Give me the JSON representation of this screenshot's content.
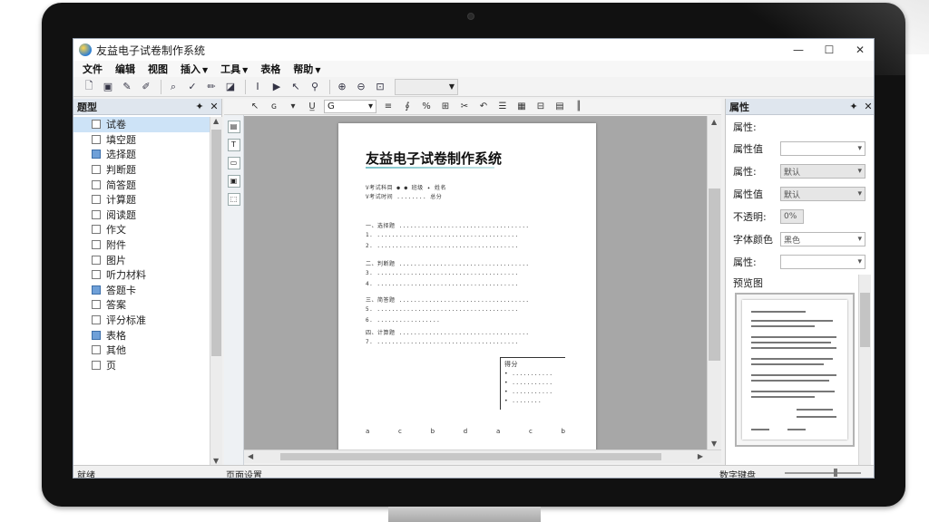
{
  "window": {
    "title": "友益电子试卷制作系统",
    "minimize": "—",
    "maximize": "☐",
    "close": "✕"
  },
  "menu": [
    {
      "label": "文件",
      "dropdown": false
    },
    {
      "label": "编辑",
      "dropdown": false
    },
    {
      "label": "视图",
      "dropdown": false
    },
    {
      "label": "插入",
      "dropdown": true
    },
    {
      "label": "工具",
      "dropdown": true
    },
    {
      "label": "表格",
      "dropdown": false
    },
    {
      "label": "帮助",
      "dropdown": true
    }
  ],
  "left_panel": {
    "title": "题型",
    "pin": "✦",
    "close": "✕",
    "items": [
      {
        "label": "试卷",
        "checked": false,
        "selected": true
      },
      {
        "label": "填空题",
        "checked": false,
        "selected": false
      },
      {
        "label": "选择题",
        "checked": true,
        "selected": false
      },
      {
        "label": "判断题",
        "checked": false,
        "selected": false
      },
      {
        "label": "简答题",
        "checked": false,
        "selected": false
      },
      {
        "label": "计算题",
        "checked": false,
        "selected": false
      },
      {
        "label": "阅读题",
        "checked": false,
        "selected": false
      },
      {
        "label": "作文",
        "checked": false,
        "selected": false
      },
      {
        "label": "附件",
        "checked": false,
        "selected": false
      },
      {
        "label": "图片",
        "checked": false,
        "selected": false
      },
      {
        "label": "听力材料",
        "checked": false,
        "selected": false
      },
      {
        "label": "答题卡",
        "checked": true,
        "selected": false
      },
      {
        "label": "答案",
        "checked": false,
        "selected": false
      },
      {
        "label": "评分标准",
        "checked": false,
        "selected": false
      },
      {
        "label": "表格",
        "checked": true,
        "selected": false
      },
      {
        "label": "其他",
        "checked": false,
        "selected": false
      },
      {
        "label": "页",
        "checked": false,
        "selected": false
      }
    ]
  },
  "editor_toolbar": {
    "font_value": "G"
  },
  "document": {
    "title": "友益电子试卷制作系统",
    "lines": [
      "V考试科目    ● ● 班级       ✦ 姓名",
      "V考试时间 ........ 总分",
      "一、选择题 ...................................",
      "   1. ......................................",
      "   2. ......................................",
      "二、判断题 ...................................",
      "   3. ......................................",
      "   4. ......................................",
      "三、简答题 ...................................",
      "   5. ......................................",
      "   6. .................",
      "四、计算题 ...................................",
      "   7. ......................................"
    ],
    "score_box_label": "得分",
    "answer_letters": [
      "a",
      "c",
      "b",
      "d",
      "a",
      "c",
      "b"
    ]
  },
  "right_panel": {
    "title": "属性",
    "pin": "✦",
    "close": "✕",
    "section_label": "属性:",
    "rows": [
      {
        "label": "属性值",
        "value": "",
        "type": "select"
      },
      {
        "label": "属性:",
        "value": "默认",
        "type": "select-grey"
      },
      {
        "label": "属性值",
        "value": "默认",
        "type": "select-grey"
      },
      {
        "label": "不透明:",
        "value": "0%",
        "type": "short"
      },
      {
        "label": "字体颜色",
        "value": "黑色",
        "type": "select"
      },
      {
        "label": "属性:",
        "value": "",
        "type": "select"
      }
    ],
    "preview_label": "预览图"
  },
  "status": {
    "left": "就绪",
    "middle": "页面设置",
    "right": "数字键盘"
  },
  "colors": {
    "accent": "#2c7fd6",
    "selection": "#cde3f7",
    "panel_header": "#dfe6ee"
  }
}
